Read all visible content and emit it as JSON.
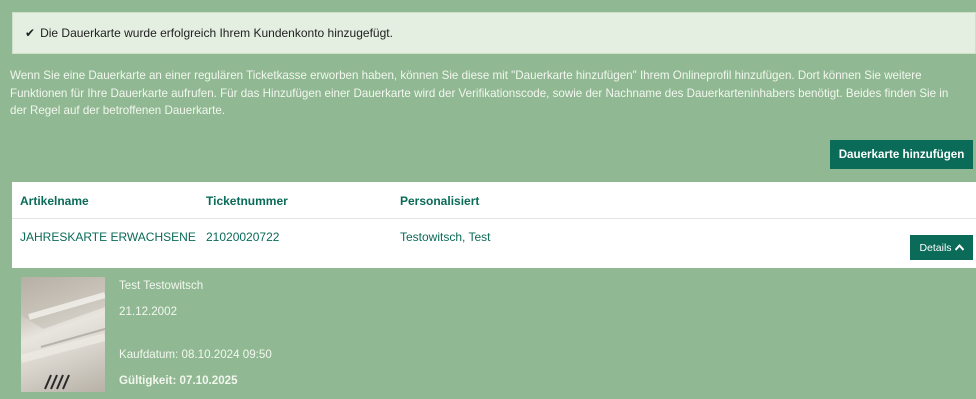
{
  "alert": {
    "icon": "check-icon",
    "message": "Die Dauerkarte wurde erfolgreich Ihrem Kundenkonto hinzugefügt."
  },
  "info": {
    "line1": "Wenn Sie eine Dauerkarte an einer regulären Ticketkasse erworben haben, können Sie diese mit \"Dauerkarte hinzufügen\" Ihrem Onlineprofil hinzufügen. Dort können Sie weitere",
    "line2": "Funktionen für Ihre Dauerkarte aufrufen. Für das Hinzufügen einer Dauerkarte wird der Verifikationscode, sowie der Nachname des Dauerkarteninhabers benötigt. Beides finden Sie in",
    "line3": "der Regel auf der betroffenen Dauerkarte."
  },
  "add_button": {
    "label": "Dauerkarte hinzufügen"
  },
  "table": {
    "headers": [
      "Artikelname",
      "Ticketnummer",
      "Personalisiert"
    ],
    "rows": [
      {
        "artikel": "JAHRESKARTE ERWACHSENE",
        "ticketnummer": "21020020722",
        "personalisiert": "Testowitsch, Test",
        "details_label": "Details",
        "details_icon": "chevron-up-icon"
      }
    ]
  },
  "detail": {
    "name": "Test Testowitsch",
    "birthdate": "21.12.2002",
    "kaufdatum": "Kaufdatum: 08.10.2024 09:50",
    "gueltigkeit": "Gültigkeit: 07.10.2025"
  },
  "colors": {
    "page_bg": "#90b893",
    "accent": "#0a6b58",
    "alert_bg": "#e4efe1"
  }
}
